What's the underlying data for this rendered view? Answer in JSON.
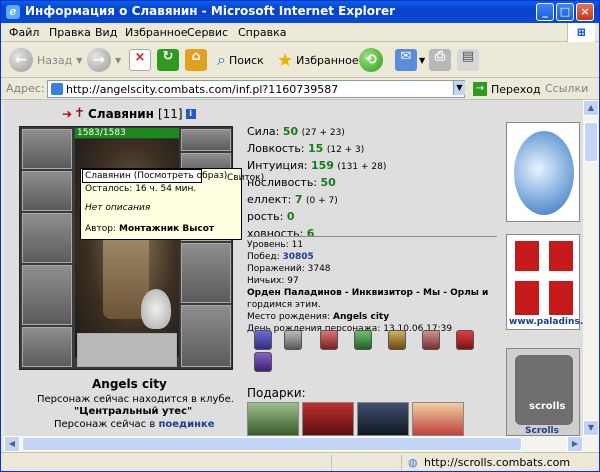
{
  "window": {
    "title": "Информация о Славянин - Microsoft Internet Explorer",
    "controls": [
      "minimize",
      "maximize",
      "close"
    ]
  },
  "menu": [
    "Файл",
    "Правка",
    "Вид",
    "Избранное",
    "Сервис",
    "Справка"
  ],
  "toolbar": {
    "back_label": "Назад",
    "search_label": "Поиск",
    "favorites_label": "Избранное"
  },
  "address_bar": {
    "label": "Адрес:",
    "url": "http://angelscity.combats.com/inf.pl?1160739587",
    "go_label": "Переход",
    "links_label": "Ссылки"
  },
  "character": {
    "name": "Славянин",
    "level": "[11]",
    "hp": "1583/1583",
    "city": "Angels city",
    "location_line1": "Персонаж сейчас находится в клубе.",
    "location_line2": "\"Центральный утес\"",
    "location_line3_prefix": "Персонаж сейчас в",
    "location_line3_link": "поединке"
  },
  "tooltip": {
    "header": "Славянин (Посмотреть образ)",
    "side": "Свиток)",
    "remaining": "Осталось: 16 ч. 54 мин.",
    "description": "Нет описания",
    "author_label": "Автор:",
    "author": "Монтажник Высот"
  },
  "stats": [
    {
      "label": "Сила:",
      "value": "50",
      "sub": "(27 + 23)"
    },
    {
      "label": "Ловкость:",
      "value": "15",
      "sub": "(12 + 3)"
    },
    {
      "label": "Интуиция:",
      "value": "159",
      "sub": "(131 + 28)"
    },
    {
      "label": "носливость:",
      "value": "50",
      "sub": ""
    },
    {
      "label": "еллект:",
      "value": "7",
      "sub": "(0 + 7)"
    },
    {
      "label": "рость:",
      "value": "0",
      "sub": ""
    },
    {
      "label": "ховность:",
      "value": "6",
      "sub": ""
    }
  ],
  "info": {
    "level": "Уровень: 11",
    "wins_label": "Побед:",
    "wins": "30805",
    "losses": "Поражений: 3748",
    "draws": "Ничьих: 97",
    "order_line": "Орден Паладинов - Инквизитор - Мы - Орлы и",
    "order_line2": "гордимся этим.",
    "birthplace_label": "Место рождения:",
    "birthplace": "Angels city",
    "birthday": "День рождения персонажа: 13.10.06 17:39"
  },
  "gifts_label": "Подарки:",
  "banners": {
    "paladins": "www.paladins.r",
    "scrolls": "scrolls",
    "scrolls2": "Scrolls"
  },
  "status_bar": {
    "text": "http://scrolls.combats.com"
  },
  "colors": {
    "title_blue": "#0a4ad4",
    "stat_green": "#1a7a1a",
    "link_blue": "#1b3e8c",
    "hp_green": "#1b8a1b"
  }
}
